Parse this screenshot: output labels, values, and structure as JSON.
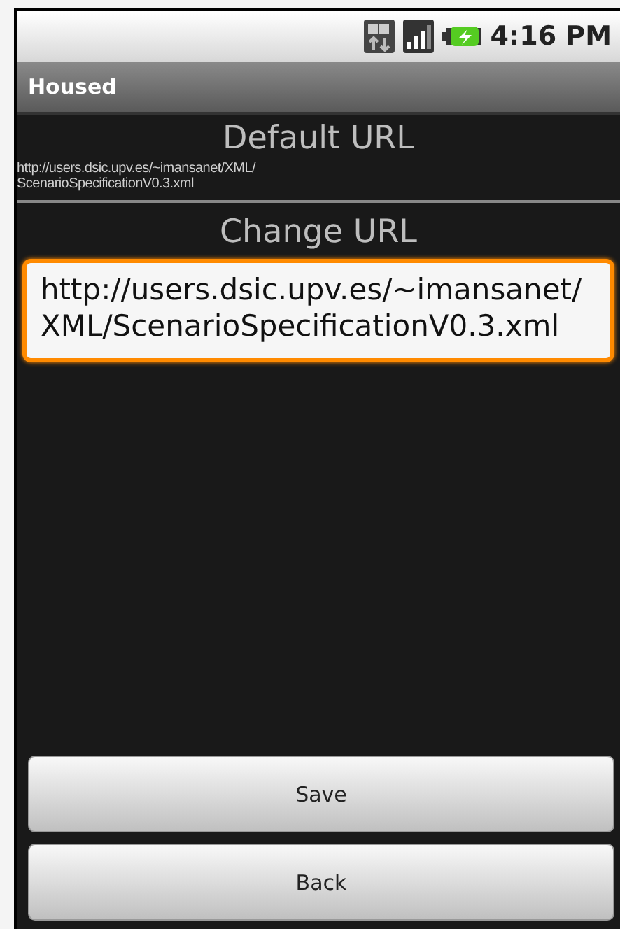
{
  "status_bar": {
    "time": "4:16 PM"
  },
  "title_bar": {
    "title": "Housed"
  },
  "default_section": {
    "heading": "Default URL",
    "url": "http://users.dsic.upv.es/~imansanet/XML/ScenarioSpecificationV0.3.xml"
  },
  "change_section": {
    "heading": "Change URL",
    "field": {
      "value": "http://users.dsic.upv.es/~imansanet/XML/ScenarioSpecificationV0.3.xml",
      "focused": true
    }
  },
  "buttons": [
    {
      "label": "Save"
    },
    {
      "label": "Back"
    }
  ]
}
